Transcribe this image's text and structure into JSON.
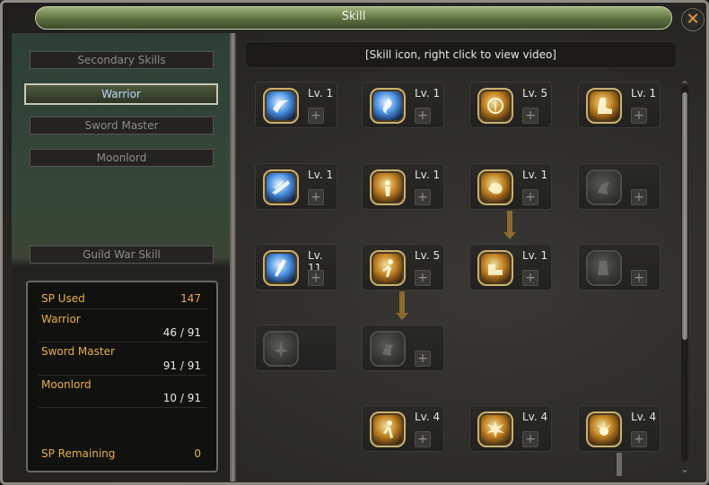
{
  "window": {
    "title": "Skill",
    "close_glyph": "✕"
  },
  "left_menu": {
    "items": [
      {
        "label": "Secondary Skills",
        "active": false
      },
      {
        "label": "Warrior",
        "active": true
      },
      {
        "label": "Sword Master",
        "active": false
      },
      {
        "label": "Moonlord",
        "active": false
      }
    ],
    "guild_war": {
      "label": "Guild War Skill"
    }
  },
  "sp_panel": {
    "sp_used_label": "SP Used",
    "sp_used_value": "147",
    "classes": [
      {
        "label": "Warrior",
        "value": "46 / 91"
      },
      {
        "label": "Sword Master",
        "value": "91 / 91"
      },
      {
        "label": "Moonlord",
        "value": "10 / 91"
      }
    ],
    "sp_remaining_label": "SP Remaining",
    "sp_remaining_value": "0"
  },
  "tree": {
    "header": "[Skill icon, right click to view video]",
    "plus_glyph": "+",
    "skills": {
      "r1c1": {
        "level": "Lv. 1",
        "icon": "blue-wave-icon",
        "style": "blue"
      },
      "r1c2": {
        "level": "Lv. 1",
        "icon": "blue-swirl-icon",
        "style": "blue"
      },
      "r1c3": {
        "level": "Lv. 5",
        "icon": "golden-burst-icon",
        "style": "gold"
      },
      "r1c4": {
        "level": "Lv. 1",
        "icon": "golden-boot-icon",
        "style": "gold"
      },
      "r2c1": {
        "level": "Lv. 1",
        "icon": "blue-slash-icon",
        "style": "blue"
      },
      "r2c2": {
        "level": "Lv. 1",
        "icon": "golden-figure-icon",
        "style": "gold"
      },
      "r2c3": {
        "level": "Lv. 1",
        "icon": "golden-fist-icon",
        "style": "gold"
      },
      "r2c4": {
        "level": "",
        "icon": "locked-skill-icon",
        "style": "gray"
      },
      "r3c1": {
        "level": "Lv. 11",
        "icon": "blue-blade-icon",
        "style": "blue"
      },
      "r3c2": {
        "level": "Lv. 5",
        "icon": "golden-runner-icon",
        "style": "gold"
      },
      "r3c3": {
        "level": "Lv. 1",
        "icon": "golden-kick-icon",
        "style": "gold"
      },
      "r3c4": {
        "level": "",
        "icon": "locked-skill-icon",
        "style": "gray"
      },
      "r4c1": {
        "level": "",
        "icon": "locked-skill-icon",
        "style": "gray"
      },
      "r4c2": {
        "level": "",
        "icon": "locked-skill-icon",
        "style": "gray"
      },
      "r5c2": {
        "level": "Lv. 4",
        "icon": "golden-leap-icon",
        "style": "gold"
      },
      "r5c3": {
        "level": "Lv. 4",
        "icon": "golden-explosion-icon",
        "style": "gold"
      },
      "r5c4": {
        "level": "Lv. 4",
        "icon": "golden-rays-icon",
        "style": "gold"
      }
    }
  }
}
